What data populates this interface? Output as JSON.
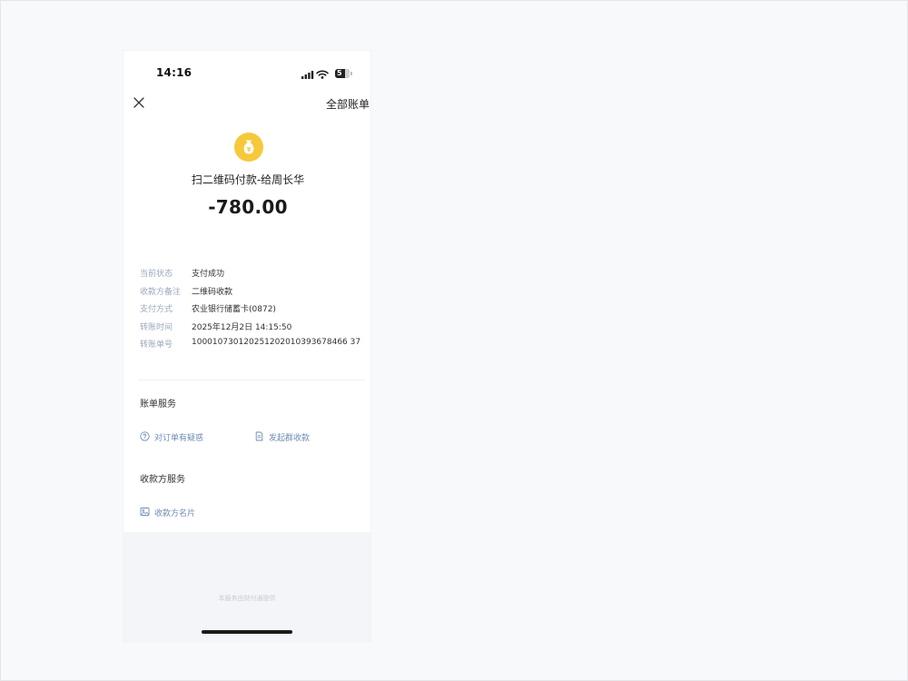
{
  "status_bar": {
    "time": "14:16",
    "battery": "5"
  },
  "nav": {
    "all_bills": "全部账单"
  },
  "transaction": {
    "title": "扫二维码付款-给周长华",
    "amount": "-780.00",
    "icon": "money-bag-icon",
    "icon_color": "#f6c93b"
  },
  "details": [
    {
      "label": "当前状态",
      "value": "支付成功"
    },
    {
      "label": "收款方备注",
      "value": "二维码收款"
    },
    {
      "label": "支付方式",
      "value": "农业银行储蓄卡(0872)"
    },
    {
      "label": "转账时间",
      "value": "2025年12月2日 14:15:50"
    },
    {
      "label": "转账单号",
      "value": "100010730120251202010393678466 37"
    }
  ],
  "bill_service": {
    "title": "账单服务",
    "dispute": "对订单有疑惑",
    "group_collect": "发起群收款"
  },
  "payee_service": {
    "title": "收款方服务",
    "payee_card": "收款方名片"
  },
  "footer": {
    "note": "本服务由财付通提供"
  },
  "colors": {
    "accent_text": "#6f8cb5",
    "label_text": "#9aa8bd"
  }
}
